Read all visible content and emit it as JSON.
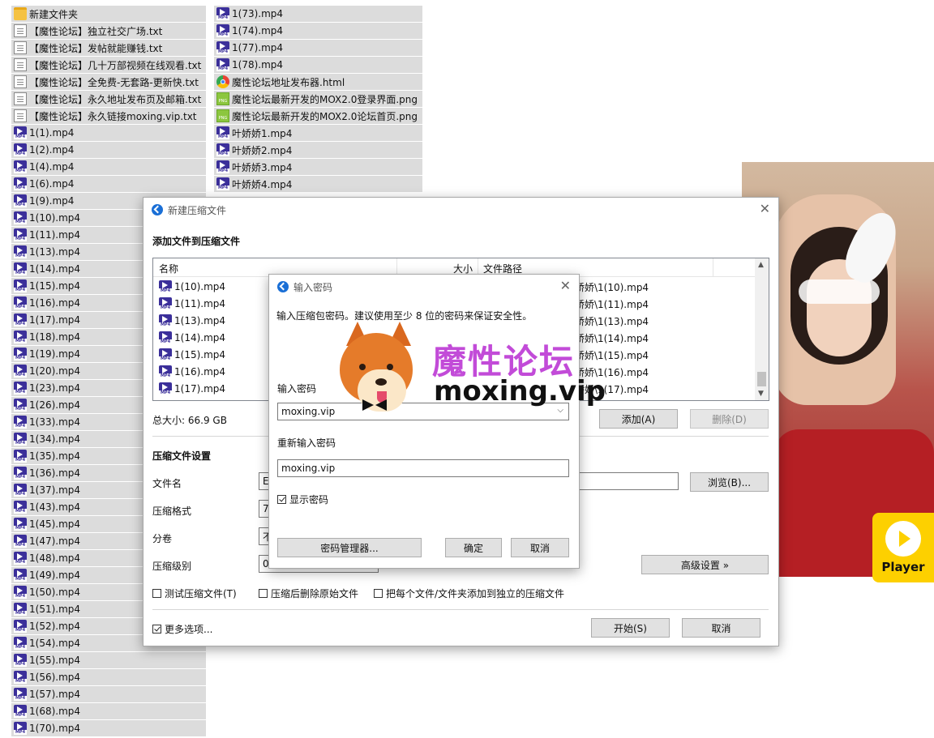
{
  "explorer": {
    "col1": [
      {
        "icon": "folder",
        "name": "新建文件夹"
      },
      {
        "icon": "txt",
        "name": "【魔性论坛】独立社交广场.txt"
      },
      {
        "icon": "txt",
        "name": "【魔性论坛】发帖就能赚钱.txt"
      },
      {
        "icon": "txt",
        "name": "【魔性论坛】几十万部视频在线观看.txt"
      },
      {
        "icon": "txt",
        "name": "【魔性论坛】全免费-无套路-更新快.txt"
      },
      {
        "icon": "txt",
        "name": "【魔性论坛】永久地址发布页及邮箱.txt"
      },
      {
        "icon": "txt",
        "name": "【魔性论坛】永久链接moxing.vip.txt"
      },
      {
        "icon": "mp4",
        "name": "1(1).mp4"
      },
      {
        "icon": "mp4",
        "name": "1(2).mp4"
      },
      {
        "icon": "mp4",
        "name": "1(4).mp4"
      },
      {
        "icon": "mp4",
        "name": "1(6).mp4"
      },
      {
        "icon": "mp4",
        "name": "1(9).mp4"
      },
      {
        "icon": "mp4",
        "name": "1(10).mp4"
      },
      {
        "icon": "mp4",
        "name": "1(11).mp4"
      },
      {
        "icon": "mp4",
        "name": "1(13).mp4"
      },
      {
        "icon": "mp4",
        "name": "1(14).mp4"
      },
      {
        "icon": "mp4",
        "name": "1(15).mp4"
      },
      {
        "icon": "mp4",
        "name": "1(16).mp4"
      },
      {
        "icon": "mp4",
        "name": "1(17).mp4"
      },
      {
        "icon": "mp4",
        "name": "1(18).mp4"
      },
      {
        "icon": "mp4",
        "name": "1(19).mp4"
      },
      {
        "icon": "mp4",
        "name": "1(20).mp4"
      },
      {
        "icon": "mp4",
        "name": "1(23).mp4"
      },
      {
        "icon": "mp4",
        "name": "1(26).mp4"
      },
      {
        "icon": "mp4",
        "name": "1(33).mp4"
      },
      {
        "icon": "mp4",
        "name": "1(34).mp4"
      },
      {
        "icon": "mp4",
        "name": "1(35).mp4"
      },
      {
        "icon": "mp4",
        "name": "1(36).mp4"
      },
      {
        "icon": "mp4",
        "name": "1(37).mp4"
      },
      {
        "icon": "mp4",
        "name": "1(43).mp4"
      },
      {
        "icon": "mp4",
        "name": "1(45).mp4"
      },
      {
        "icon": "mp4",
        "name": "1(47).mp4"
      },
      {
        "icon": "mp4",
        "name": "1(48).mp4"
      },
      {
        "icon": "mp4",
        "name": "1(49).mp4"
      },
      {
        "icon": "mp4",
        "name": "1(50).mp4"
      },
      {
        "icon": "mp4",
        "name": "1(51).mp4"
      },
      {
        "icon": "mp4",
        "name": "1(52).mp4"
      },
      {
        "icon": "mp4",
        "name": "1(54).mp4"
      },
      {
        "icon": "mp4",
        "name": "1(55).mp4"
      },
      {
        "icon": "mp4",
        "name": "1(56).mp4"
      },
      {
        "icon": "mp4",
        "name": "1(57).mp4"
      },
      {
        "icon": "mp4",
        "name": "1(68).mp4"
      },
      {
        "icon": "mp4",
        "name": "1(70).mp4"
      }
    ],
    "col2": [
      {
        "icon": "mp4",
        "name": "1(73).mp4"
      },
      {
        "icon": "mp4",
        "name": "1(74).mp4"
      },
      {
        "icon": "mp4",
        "name": "1(77).mp4"
      },
      {
        "icon": "mp4",
        "name": "1(78).mp4"
      },
      {
        "icon": "html",
        "name": "魔性论坛地址发布器.html"
      },
      {
        "icon": "png",
        "name": "魔性论坛最新开发的MOX2.0登录界面.png"
      },
      {
        "icon": "png",
        "name": "魔性论坛最新开发的MOX2.0论坛首页.png"
      },
      {
        "icon": "mp4",
        "name": "叶娇娇1.mp4"
      },
      {
        "icon": "mp4",
        "name": "叶娇娇2.mp4"
      },
      {
        "icon": "mp4",
        "name": "叶娇娇3.mp4"
      },
      {
        "icon": "mp4",
        "name": "叶娇娇4.mp4"
      }
    ]
  },
  "player_badge": {
    "label": "Player"
  },
  "compress_dialog": {
    "title": "新建压缩文件",
    "section_add": "添加文件到压缩文件",
    "col_name": "名称",
    "col_size": "大小",
    "col_path": "文件路径",
    "rows": [
      {
        "name": "1(10).mp4",
        "path": "娇娇\\1(10).mp4"
      },
      {
        "name": "1(11).mp4",
        "path": "娇娇\\1(11).mp4"
      },
      {
        "name": "1(13).mp4",
        "path": "娇娇\\1(13).mp4"
      },
      {
        "name": "1(14).mp4",
        "path": "娇娇\\1(14).mp4"
      },
      {
        "name": "1(15).mp4",
        "path": "娇娇\\1(15).mp4"
      },
      {
        "name": "1(16).mp4",
        "path": "娇娇\\1(16).mp4"
      },
      {
        "name": "1(17).mp4",
        "path": "娇娇\\1(17).mp4"
      }
    ],
    "total_size": "总大小: 66.9 GB",
    "btn_add": "添加(A)",
    "btn_delete": "删除(D)",
    "section_settings": "压缩文件设置",
    "lbl_filename": "文件名",
    "val_filename": "E",
    "btn_browse": "浏览(B)...",
    "lbl_format": "压缩格式",
    "val_format": "7",
    "lbl_split": "分卷",
    "val_split": "不",
    "lbl_level": "压缩级别",
    "val_level": "0",
    "btn_advanced": "高级设置 »",
    "chk_test": "测试压缩文件(T)",
    "chk_delete": "压缩后删除原始文件",
    "chk_each": "把每个文件/文件夹添加到独立的压缩文件",
    "chk_more": "更多选项...",
    "btn_start": "开始(S)",
    "btn_cancel": "取消"
  },
  "password_dialog": {
    "title": "输入密码",
    "hint": "输入压缩包密码。建议使用至少 8 位的密码来保证安全性。",
    "lbl_password": "输入密码",
    "val_password": "moxing.vip",
    "lbl_repeat": "重新输入密码",
    "val_repeat": "moxing.vip",
    "chk_show": "显示密码",
    "btn_manager": "密码管理器...",
    "btn_ok": "确定",
    "btn_cancel": "取消"
  },
  "watermark": {
    "cn": "魔性论坛",
    "en": "moxing.vip"
  },
  "colors": {
    "accent": "#1a6fd6",
    "watermark_purple": "#c24bd8",
    "badge_yellow": "#fdd000"
  }
}
